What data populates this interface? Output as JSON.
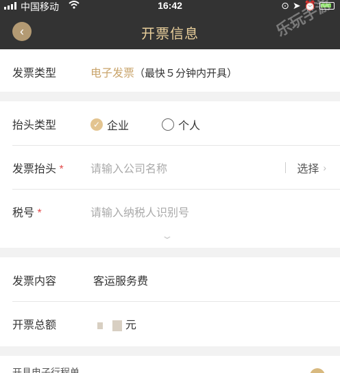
{
  "status_bar": {
    "carrier": "中国移动",
    "time": "16:42"
  },
  "header": {
    "title": "开票信息",
    "watermark": "乐玩手游"
  },
  "invoice_type": {
    "label": "发票类型",
    "value_highlight": "电子发票",
    "value_note": "（最快５分钟内开具）"
  },
  "header_type": {
    "label": "抬头类型",
    "options": [
      "企业",
      "个人"
    ],
    "selected": "企业"
  },
  "invoice_header": {
    "label": "发票抬头",
    "required_mark": "*",
    "placeholder": "请输入公司名称",
    "select_label": "选择"
  },
  "tax_no": {
    "label": "税号",
    "required_mark": "*",
    "placeholder": "请输入纳税人识别号"
  },
  "invoice_content": {
    "label": "发票内容",
    "value": "客运服务费"
  },
  "invoice_total": {
    "label": "开票总额",
    "unit": "元"
  },
  "bottom": {
    "partial_label": "开具电子行程单"
  },
  "colors": {
    "header_bg": "#333333",
    "title": "#e9cf9b",
    "accent": "#c9a46b",
    "required": "#e24a4a"
  }
}
